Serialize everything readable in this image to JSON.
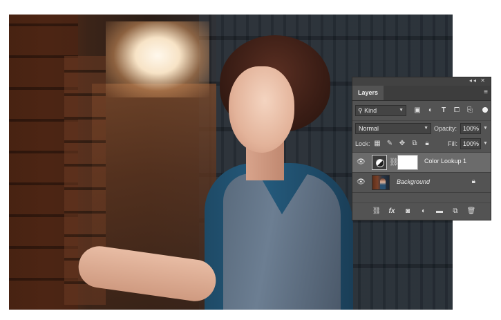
{
  "panel": {
    "tab_label": "Layers",
    "collapse_glyph": "◂◂",
    "close_glyph": "✕",
    "menu_glyph": "≡"
  },
  "filter": {
    "kind_label": "Kind",
    "icons": [
      "image-filter-icon",
      "adjustment-filter-icon",
      "type-filter-icon",
      "shape-filter-icon",
      "smart-object-filter-icon"
    ]
  },
  "blend": {
    "mode": "Normal",
    "opacity_label": "Opacity:",
    "opacity_value": "100%",
    "fill_label": "Fill:",
    "fill_value": "100%"
  },
  "lock": {
    "label": "Lock:"
  },
  "layers": [
    {
      "name": "Color Lookup 1",
      "type": "adjustment",
      "visible": true,
      "selected": true
    },
    {
      "name": "Background",
      "type": "pixel",
      "visible": true,
      "selected": false,
      "locked": true
    }
  ],
  "footer_icons": [
    "link-layers-icon",
    "fx-icon",
    "add-mask-icon",
    "new-adjustment-icon",
    "new-group-icon",
    "new-layer-icon",
    "delete-layer-icon"
  ],
  "footer_fx_label": "fx",
  "colors": {
    "panel_bg": "#535353",
    "selected_row": "#6b6b6b",
    "tab_bar": "#3d3d3d"
  }
}
